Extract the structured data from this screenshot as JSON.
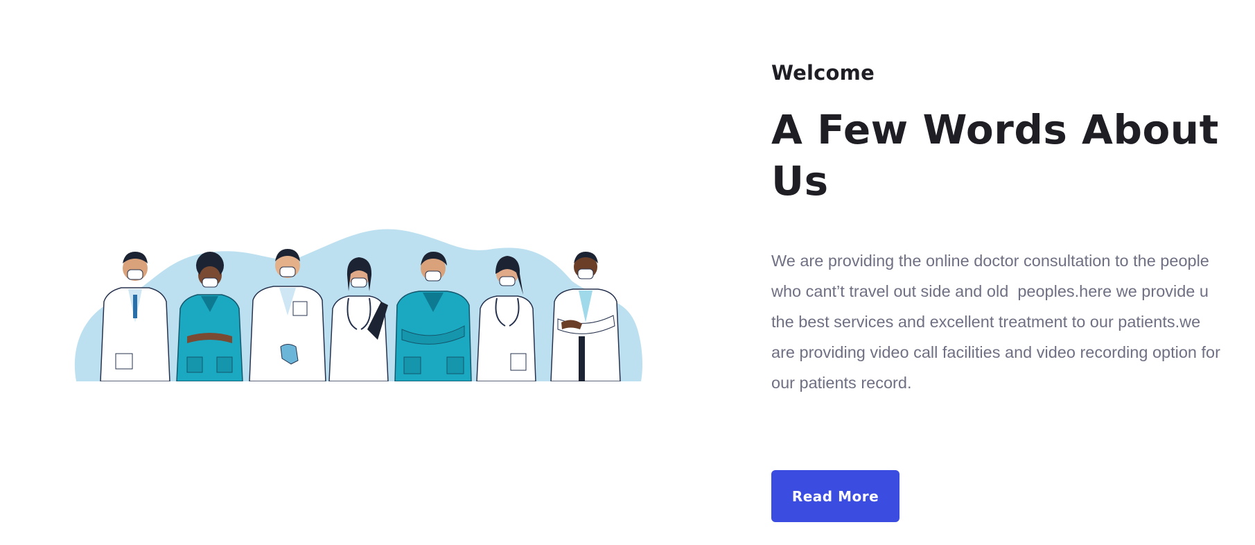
{
  "about": {
    "eyebrow": "Welcome",
    "heading": "A Few Words About Us",
    "body": "We are providing the online doctor consultation to the people who cant’t travel out side and old  peoples.here we provide u the best services and excellent treatment to our patients.we are providing video call facilities and video recording option for our patients record.",
    "button_label": "Read More"
  },
  "illustration": {
    "icon": "medical-team-illustration",
    "people_count": 7
  },
  "colors": {
    "button": "#3b4ce0",
    "heading": "#1e1e24",
    "body_text": "#6f7083",
    "illustration_blob": "#bde0f0",
    "scrubs_teal": "#1ba9c2"
  }
}
